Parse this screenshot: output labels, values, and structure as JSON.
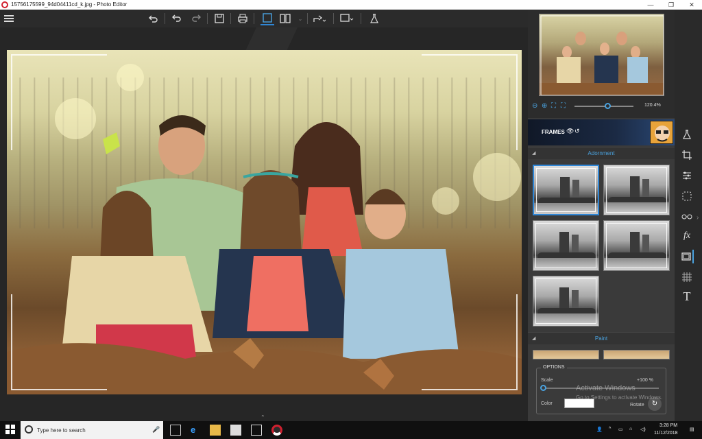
{
  "window": {
    "title": "15756175599_94d04411cd_k.jpg - Photo Editor",
    "minimize": "—",
    "restore": "❐",
    "close": "✕"
  },
  "toolbar": {
    "menu_icon": "menu-icon",
    "undo_all_icon": "undo-all-icon",
    "undo_icon": "undo-icon",
    "redo_icon": "redo-icon",
    "save_icon": "save-icon",
    "print_icon": "print-icon",
    "single_view_icon": "single-view-icon",
    "compare_view_icon": "compare-view-icon",
    "share_icon": "share-icon",
    "export_icon": "export-icon",
    "lab_icon": "lab-icon"
  },
  "navigator": {
    "zoom_value": "120.4%",
    "zoom_level": 0.6
  },
  "frames": {
    "label": "FRAMES"
  },
  "sections": {
    "adornment": "Adornment",
    "paint": "Paint"
  },
  "frame_tiles": [
    {
      "name": "frame-1",
      "selected": true
    },
    {
      "name": "frame-2",
      "selected": false
    },
    {
      "name": "frame-3",
      "selected": false
    },
    {
      "name": "frame-4",
      "selected": false
    },
    {
      "name": "frame-5",
      "selected": false
    }
  ],
  "options": {
    "label": "OPTIONS",
    "scale_label": "Scale",
    "scale_value": "+100 %",
    "color_label": "Color",
    "rotate_label": "Rotate",
    "color_value": "#ffffff"
  },
  "watermark": {
    "line1": "Activate Windows",
    "line2": "Go to Settings to activate Windows."
  },
  "taskbar": {
    "search_placeholder": "Type here to search",
    "time": "3:28 PM",
    "date": "11/12/2018"
  },
  "colors": {
    "accent": "#2f86d6",
    "panel": "#3a3a3a",
    "toolbar": "#2b2b2b"
  }
}
